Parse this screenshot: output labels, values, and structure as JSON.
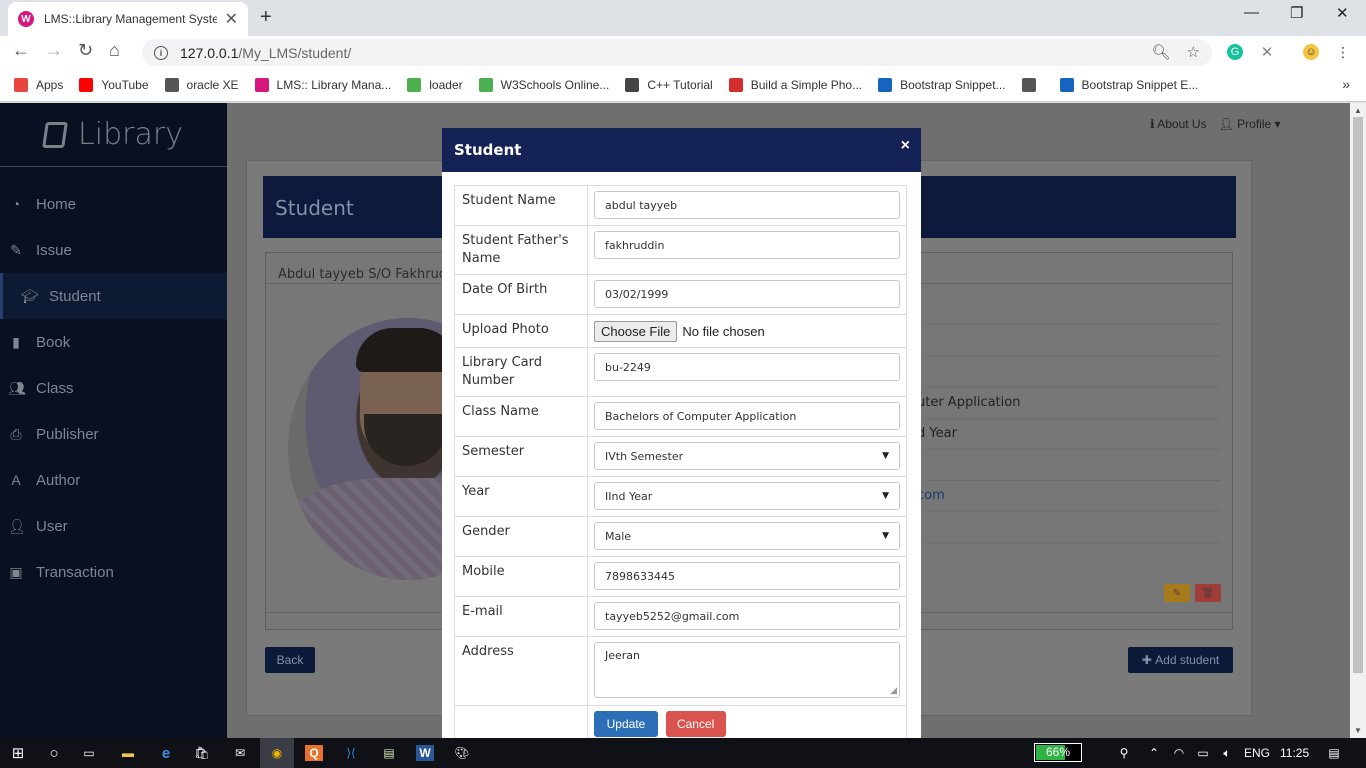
{
  "browser": {
    "tab_title": "LMS::Library Management System",
    "tab_favicon": "lms-logo-icon",
    "url_host": "127.0.0.1",
    "url_path": "/My_LMS/student/",
    "bookmarks": [
      {
        "label": "Apps",
        "icon": "apps-grid-icon",
        "color": "#e8453c"
      },
      {
        "label": "YouTube",
        "icon": "youtube-icon",
        "color": "#ff0000"
      },
      {
        "label": "oracle XE",
        "icon": "globe-icon",
        "color": "#555555"
      },
      {
        "label": "LMS:: Library Mana...",
        "icon": "lms-logo-icon",
        "color": "#d6187e"
      },
      {
        "label": "loader",
        "icon": "w3-icon",
        "color": "#4caf50"
      },
      {
        "label": "W3Schools Online...",
        "icon": "w3-icon",
        "color": "#4caf50"
      },
      {
        "label": "C++ Tutorial",
        "icon": "diamond-icon",
        "color": "#444444"
      },
      {
        "label": "Build a Simple Pho...",
        "icon": "dot-circle-icon",
        "color": "#d32f2f"
      },
      {
        "label": "Bootstrap Snippet...",
        "icon": "bootstrap-icon",
        "color": "#1565c0"
      },
      {
        "label": "",
        "icon": "globe-icon",
        "color": "#555555"
      },
      {
        "label": "Bootstrap Snippet E...",
        "icon": "bootstrap-icon",
        "color": "#1565c0"
      }
    ]
  },
  "sidebar": {
    "brand": "Library",
    "items": [
      {
        "label": "Home",
        "icon": "dashboard-icon"
      },
      {
        "label": "Issue",
        "icon": "edit-icon"
      },
      {
        "label": "Student",
        "icon": "graduation-cap-icon",
        "active": true
      },
      {
        "label": "Book",
        "icon": "book-icon"
      },
      {
        "label": "Class",
        "icon": "users-icon"
      },
      {
        "label": "Publisher",
        "icon": "print-icon"
      },
      {
        "label": "Author",
        "icon": "font-icon"
      },
      {
        "label": "User",
        "icon": "user-icon"
      },
      {
        "label": "Transaction",
        "icon": "money-icon"
      }
    ]
  },
  "topnav": {
    "about": "About Us",
    "profile": "Profile"
  },
  "main": {
    "heading": "Student",
    "card_title": "Abdul tayyeb S/O Fakhruddin",
    "details_visible": [
      "uter Application",
      "d Year",
      "com"
    ],
    "back_label": "Back",
    "add_label": "Add student"
  },
  "modal": {
    "title": "Student",
    "close": "×",
    "fields": {
      "student_name": {
        "label": "Student Name",
        "value": "abdul tayyeb"
      },
      "father_name": {
        "label": "Student Father's Name",
        "value": "fakhruddin"
      },
      "dob": {
        "label": "Date Of Birth",
        "value": "03/02/1999"
      },
      "photo": {
        "label": "Upload Photo",
        "button": "Choose File",
        "status": "No file chosen"
      },
      "card_number": {
        "label": "Library Card Number",
        "value": "bu-2249"
      },
      "class_name": {
        "label": "Class Name",
        "value": "Bachelors of Computer Application"
      },
      "semester": {
        "label": "Semester",
        "value": "IVth Semester"
      },
      "year": {
        "label": "Year",
        "value": "IInd Year"
      },
      "gender": {
        "label": "Gender",
        "value": "Male"
      },
      "mobile": {
        "label": "Mobile",
        "value": "7898633445"
      },
      "email": {
        "label": "E-mail",
        "value": "tayyeb5252@gmail.com"
      },
      "address": {
        "label": "Address",
        "value": "Jeeran"
      }
    },
    "update_label": "Update",
    "cancel_label": "Cancel"
  },
  "taskbar": {
    "battery": "66%",
    "battery_level": 0.66,
    "language": "ENG",
    "time": "11:25"
  }
}
